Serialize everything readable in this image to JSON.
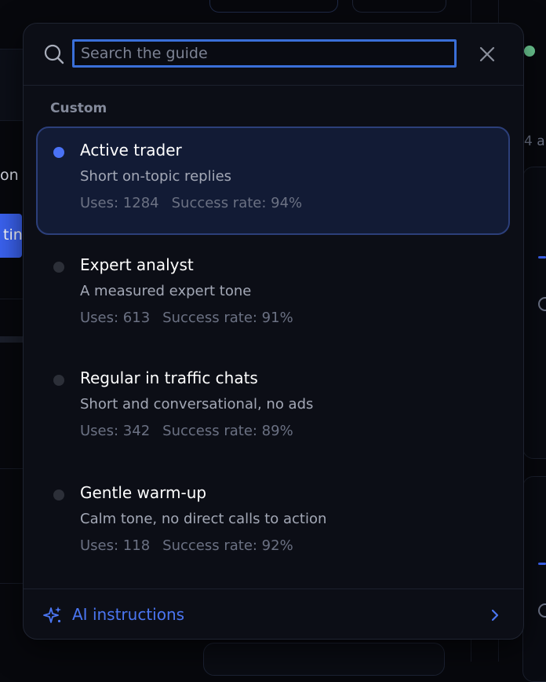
{
  "search": {
    "placeholder": "Search the guide",
    "value": ""
  },
  "section": {
    "label": "Custom"
  },
  "presets": [
    {
      "title": "Active trader",
      "description": "Short on-topic replies",
      "uses": "Uses: 1284",
      "success": "Success rate: 94%",
      "selected": true
    },
    {
      "title": "Expert analyst",
      "description": "A measured expert tone",
      "uses": "Uses: 613",
      "success": "Success rate: 91%",
      "selected": false
    },
    {
      "title": "Regular in traffic chats",
      "description": "Short and conversational, no ads",
      "uses": "Uses: 342",
      "success": "Success rate: 89%",
      "selected": false
    },
    {
      "title": "Gentle warm-up",
      "description": "Calm tone, no direct calls to action",
      "uses": "Uses: 118",
      "success": "Success rate: 92%",
      "selected": false
    }
  ],
  "footer": {
    "label": "AI instructions"
  },
  "background": {
    "left_text": "on",
    "left_button_text": "tin",
    "right_text": "4 a"
  },
  "colors": {
    "accent": "#4a72f5",
    "selected_bg": "#121b35",
    "status_dot": "#6fcf97"
  },
  "icons": {
    "search": "search-icon",
    "close": "close-icon",
    "footer": "sparkle-icon",
    "footer_chevron": "chevron-right-icon"
  }
}
